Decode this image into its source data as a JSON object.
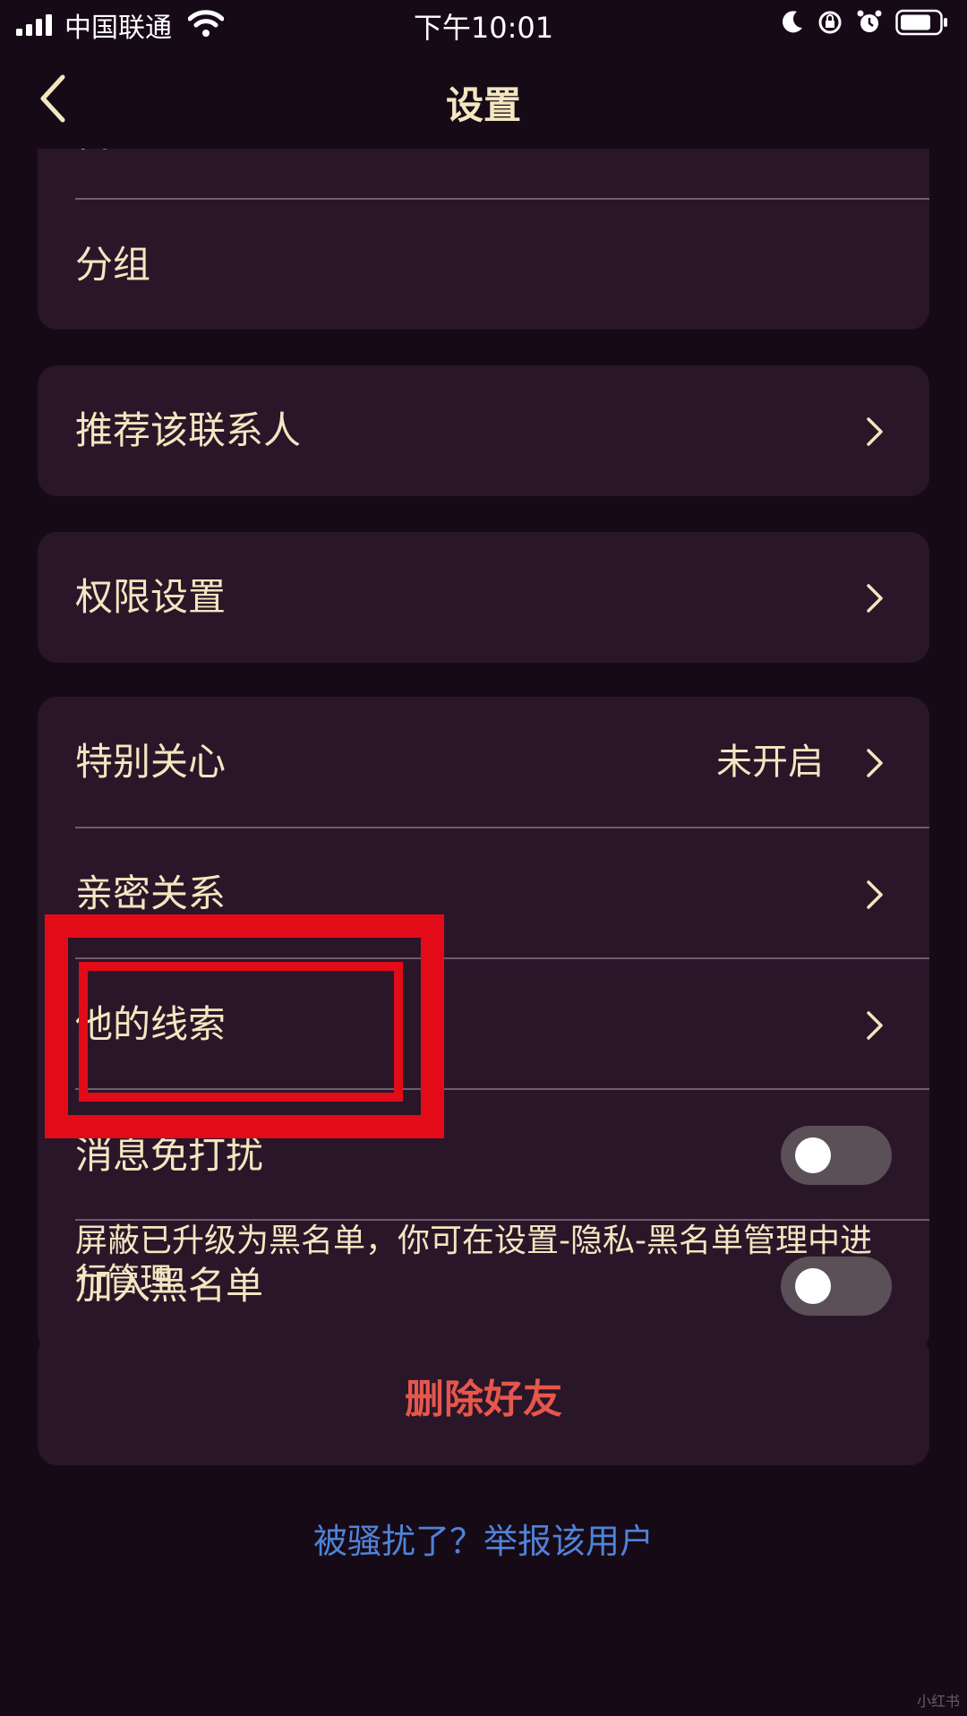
{
  "status_bar": {
    "carrier": "中国联通",
    "time": "下午10:01"
  },
  "nav": {
    "title": "设置"
  },
  "groups": [
    {
      "rows": [
        {
          "label": "备注"
        },
        {
          "label": "分组"
        }
      ]
    },
    {
      "rows": [
        {
          "label": "推荐该联系人"
        }
      ]
    },
    {
      "rows": [
        {
          "label": "权限设置"
        }
      ]
    },
    {
      "rows": [
        {
          "label": "特别关心",
          "value": "未开启"
        },
        {
          "label": "亲密关系"
        },
        {
          "label": "他的线索"
        },
        {
          "label": "消息免打扰",
          "toggle": false
        },
        {
          "label": "加入黑名单",
          "toggle": false
        }
      ]
    }
  ],
  "blacklist_note": "屏蔽已升级为黑名单，你可在设置-隐私-黑名单管理中进行管理。",
  "delete_label": "删除好友",
  "report_link": "被骚扰了？举报该用户",
  "watermark": "小红书",
  "colors": {
    "background": "#170a17",
    "card": "#2a1629",
    "text": "#f3e6c0",
    "danger": "#e5574c",
    "link": "#4f83d8",
    "annotation": "#e40b18"
  }
}
